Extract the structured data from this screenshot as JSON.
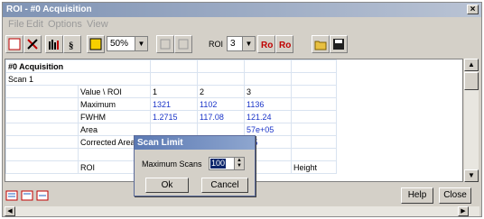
{
  "window": {
    "title": "ROI - #0   Acquisition",
    "close_glyph": "×"
  },
  "menu": {
    "items": [
      "File",
      "Edit",
      "Options",
      "View"
    ]
  },
  "toolbar": {
    "zoom_value": "50%",
    "roi_label": "ROI",
    "roi_value": "3"
  },
  "table": {
    "title": "#0  Acquisition",
    "subtitle": "Scan 1",
    "rows": [
      [
        "",
        "Value  \\  ROI",
        "1",
        "2",
        "3",
        ""
      ],
      [
        "",
        "Maximum",
        "1321",
        "1102",
        "1136",
        ""
      ],
      [
        "",
        "FWHM",
        "1.2715",
        "117.08",
        "121.24",
        ""
      ],
      [
        "",
        "Area",
        "",
        "",
        "57e+05",
        ""
      ],
      [
        "",
        "Corrected Area",
        "",
        "",
        "8.5",
        ""
      ],
      [
        "",
        "",
        "",
        "",
        "",
        ""
      ],
      [
        "",
        "ROI",
        "",
        "",
        "th",
        "Height"
      ]
    ]
  },
  "dialog": {
    "title": "Scan Limit",
    "field_label": "Maximum Scans",
    "field_value": "100",
    "ok_label": "Ok",
    "cancel_label": "Cancel"
  },
  "buttons": {
    "help": "Help",
    "close": "Close"
  },
  "colors": {
    "accent": "#1a34c8",
    "title_bar": "#7f93b4",
    "dialog_title": "#5b79b3",
    "chrome": "#d4d0c8"
  }
}
